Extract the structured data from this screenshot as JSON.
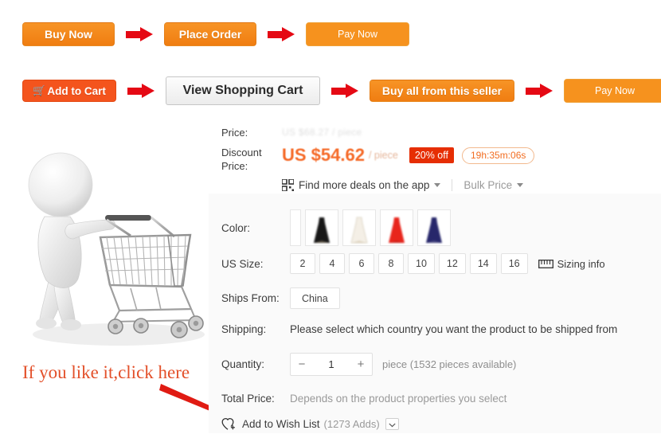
{
  "flow_steps_row1": [
    {
      "label": "Buy Now",
      "icon": "",
      "name": "buy-now-button"
    },
    {
      "label": "Place Order",
      "icon": "",
      "name": "place-order-button"
    },
    {
      "label": "Pay Now",
      "icon": "",
      "name": "pay-now-button-1"
    }
  ],
  "flow_steps_row2": [
    {
      "label": "Add to Cart",
      "icon": "shopping-cart-icon",
      "name": "add-to-cart-button"
    },
    {
      "label": "View Shopping Cart",
      "icon": "",
      "name": "view-shopping-cart-button"
    },
    {
      "label": "Buy all from this seller",
      "icon": "",
      "name": "buy-all-from-seller-button"
    },
    {
      "label": "Pay Now",
      "icon": "",
      "name": "pay-now-button-2"
    }
  ],
  "arrow_icon": "right-arrow-icon",
  "illustration": {
    "name": "shopper-pushing-cart-illustration",
    "alt": "3D white figure pushing a metal shopping cart"
  },
  "annotation": {
    "text": "If you like it,click here",
    "arrow_icon": "annotation-arrow-icon",
    "color": "#e3502a"
  },
  "price": {
    "price_label": "Price:",
    "original_price": "US $68.27 / piece",
    "discount_label": "Discount Price:",
    "discount_price": "US $54.62",
    "unit": "/ piece",
    "discount_badge": "20% off",
    "countdown": "19h:35m:06s",
    "badge_color": "#e62e04",
    "price_color": "#f56a28",
    "app_deals_label": "Find more deals on the app",
    "app_icon": "qr-code-icon",
    "bulk_price_label": "Bulk Price"
  },
  "properties": {
    "color": {
      "label": "Color:",
      "swatches": [
        {
          "name": "swatch-black",
          "color": "#1a1a1a"
        },
        {
          "name": "swatch-white",
          "color": "#f2ece2"
        },
        {
          "name": "swatch-red",
          "color": "#e8251c"
        },
        {
          "name": "swatch-navy",
          "color": "#27276b"
        }
      ]
    },
    "us_size": {
      "label": "US Size:",
      "options": [
        "2",
        "4",
        "6",
        "8",
        "10",
        "12",
        "14",
        "16"
      ],
      "sizing_info_label": "Sizing info",
      "sizing_info_icon": "ruler-icon"
    },
    "ships_from": {
      "label": "Ships From:",
      "options": [
        "China"
      ],
      "selected": "China"
    },
    "shipping": {
      "label": "Shipping:",
      "text": "Please select which country you want the product to be shipped from"
    },
    "quantity": {
      "label": "Quantity:",
      "value": "1",
      "minus_icon": "minus-icon",
      "plus_icon": "plus-icon",
      "hint": "piece (1532 pieces available)"
    },
    "total_price": {
      "label": "Total Price:",
      "text": "Depends on the product properties you select"
    },
    "wish_list": {
      "icon": "heart-plus-icon",
      "label": "Add to Wish List",
      "count": "(1273 Adds)",
      "dropdown_icon": "chevron-down-icon"
    }
  }
}
